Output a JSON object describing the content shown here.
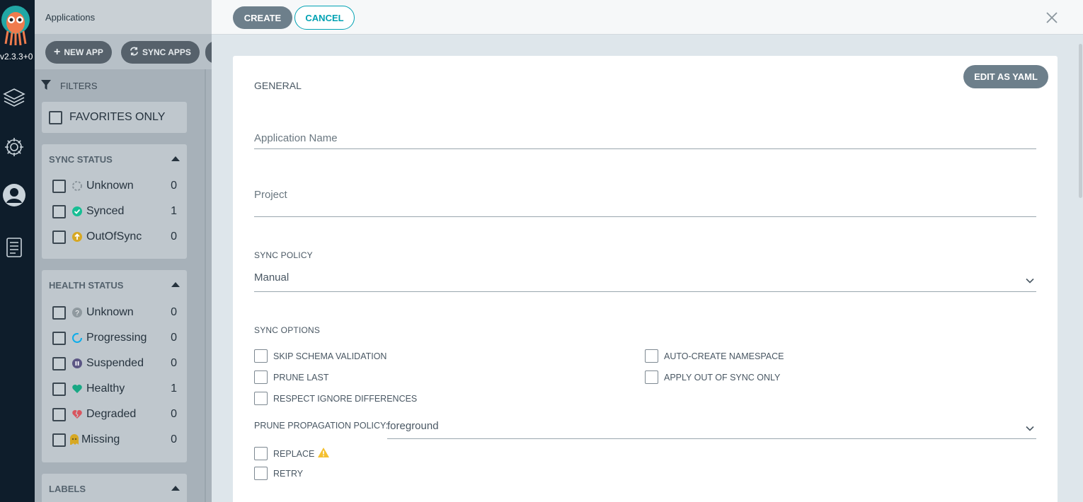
{
  "nav": {
    "version": "v2.3.3+0"
  },
  "topbar": {
    "title": "Applications"
  },
  "toolbar": {
    "new_app": "NEW APP",
    "sync_apps": "SYNC APPS"
  },
  "filters": {
    "title": "FILTERS",
    "favorites_only": "FAVORITES ONLY",
    "sync_status": {
      "title": "SYNC STATUS",
      "items": [
        {
          "label": "Unknown",
          "count": "0"
        },
        {
          "label": "Synced",
          "count": "1"
        },
        {
          "label": "OutOfSync",
          "count": "0"
        }
      ]
    },
    "health_status": {
      "title": "HEALTH STATUS",
      "items": [
        {
          "label": "Unknown",
          "count": "0"
        },
        {
          "label": "Progressing",
          "count": "0"
        },
        {
          "label": "Suspended",
          "count": "0"
        },
        {
          "label": "Healthy",
          "count": "1"
        },
        {
          "label": "Degraded",
          "count": "0"
        },
        {
          "label": "Missing",
          "count": "0"
        }
      ]
    },
    "labels": {
      "title": "LABELS"
    }
  },
  "panel": {
    "create": "CREATE",
    "cancel": "CANCEL",
    "edit_yaml": "EDIT AS YAML",
    "general": "GENERAL",
    "app_name_placeholder": "Application Name",
    "project_placeholder": "Project",
    "sync_policy_label": "SYNC POLICY",
    "sync_policy_value": "Manual",
    "sync_options_label": "SYNC OPTIONS",
    "options": {
      "skip_schema": "SKIP SCHEMA VALIDATION",
      "prune_last": "PRUNE LAST",
      "respect_ignore": "RESPECT IGNORE DIFFERENCES",
      "auto_create_ns": "AUTO-CREATE NAMESPACE",
      "apply_out_of_sync": "APPLY OUT OF SYNC ONLY",
      "replace": "REPLACE",
      "retry": "RETRY"
    },
    "prune_policy_label": "PRUNE PROPAGATION POLICY:",
    "prune_policy_value": "foreground"
  },
  "colors": {
    "accent": "#00a2b3",
    "synced": "#18be94",
    "out_of_sync": "#f4c030",
    "healthy": "#18be94",
    "degraded": "#e96d76",
    "suspended": "#766f94",
    "progressing": "#0dadea",
    "warning": "#f4c030"
  }
}
